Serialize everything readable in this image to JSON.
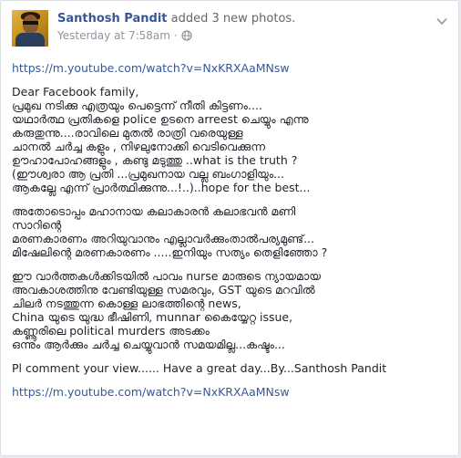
{
  "post": {
    "author": "Santhosh Pandit",
    "action": "added 3 new photos.",
    "timestamp": "Yesterday at 7:58am",
    "separator": "·",
    "privacy_icon": "globe-icon",
    "menu_icon": "chevron-down-icon",
    "link_top": "https://m.youtube.com/watch?v=NxKRXAaMNsw",
    "para1": [
      "Dear Facebook family,",
      "പ്രമുഖ നടിക്കു എത്രയും പെട്ടെന്ന് നീതി കിട്ടണം....",
      "യഥാർത്ഥ പ്രതികളെ police ഉടനെ arreest ചെയ്യും എന്നു",
      "കരുതുന്നു....രാവിലെ മുതൽ രാത്രി വരെയുള്ള",
      "ചാനൽ ചർച്ച കളും , നിഴലുനോക്കി വെടിവെക്കുന്ന",
      "ഊഹാപോഹങ്ങളും , കണ്ടു മടുത്തു ..what is the truth ?",
      "(ഈശ്വരാ ആ പ്രതി ...പ്രമുഖനായ വല്ല ബംഗാളിയും...",
      "ആകല്ലേ എന്ന് പ്രാർത്ഥിക്കുന്നു...!..)..hope for the best..."
    ],
    "para2": [
      "അതോടൊപ്പം മഹാനായ കലാകാരൻ കലാഭവൻ മണി",
      "സാറിന്റെ",
      "മരണകാരണം അറിയുവാനും എല്ലാവർക്കുംതാൽപര്യമുണ്ട്...",
      "മിഷേലിന്റെ മരണകാരണം .....ഇനിയും സത്യം തെളിഞ്ഞോ ?"
    ],
    "para3": [
      "ഈ വാർത്തകൾക്കിടയിൽ പാവം nurse മാരുടെ ന്യായമായ",
      "അവകാശത്തിനു വേണ്ടിയുള്ള സമരവും, GST യുടെ മറവിൽ",
      "ചിലർ നടത്തുന്ന കൊള്ള ലാഭത്തിന്റെ news,",
      "China യുടെ യുദ്ധ ഭീഷിണി, munnar കൈയ്യേറ്റ issue,",
      "കണ്ണൂരിലെ political murders അടക്കം",
      "ഒന്നും ആർക്കും ചർച്ച ചെയ്യുവാൻ സമയമില്ല...കഷ്ടം..."
    ],
    "closing": "Pl comment your view...... Have a great day...By...Santhosh Pandit",
    "link_bottom": "https://m.youtube.com/watch?v=NxKRXAaMNsw"
  }
}
